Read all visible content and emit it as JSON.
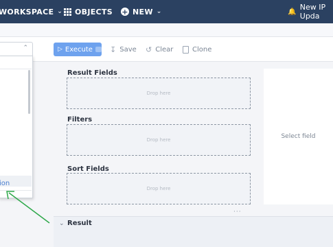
{
  "nav": {
    "workspace_label": "WORKSPACE",
    "objects_label": "OBJECTS",
    "new_label": "NEW",
    "notification_text": "New IP Upda"
  },
  "toolbar": {
    "execute_label": "Execute",
    "save_label": "Save",
    "clear_label": "Clear",
    "clone_label": "Clone"
  },
  "popup": {
    "link_text": "ion"
  },
  "builder": {
    "result_fields_label": "Result Fields",
    "filters_label": "Filters",
    "sort_fields_label": "Sort Fields",
    "drop_placeholder": "Drop here",
    "properties_placeholder": "Select field"
  },
  "result": {
    "label": "Result"
  },
  "colors": {
    "nav_bg": "#2b4161",
    "execute_btn": "#6ea2ee",
    "annotation_arrow": "#2ea84a"
  }
}
